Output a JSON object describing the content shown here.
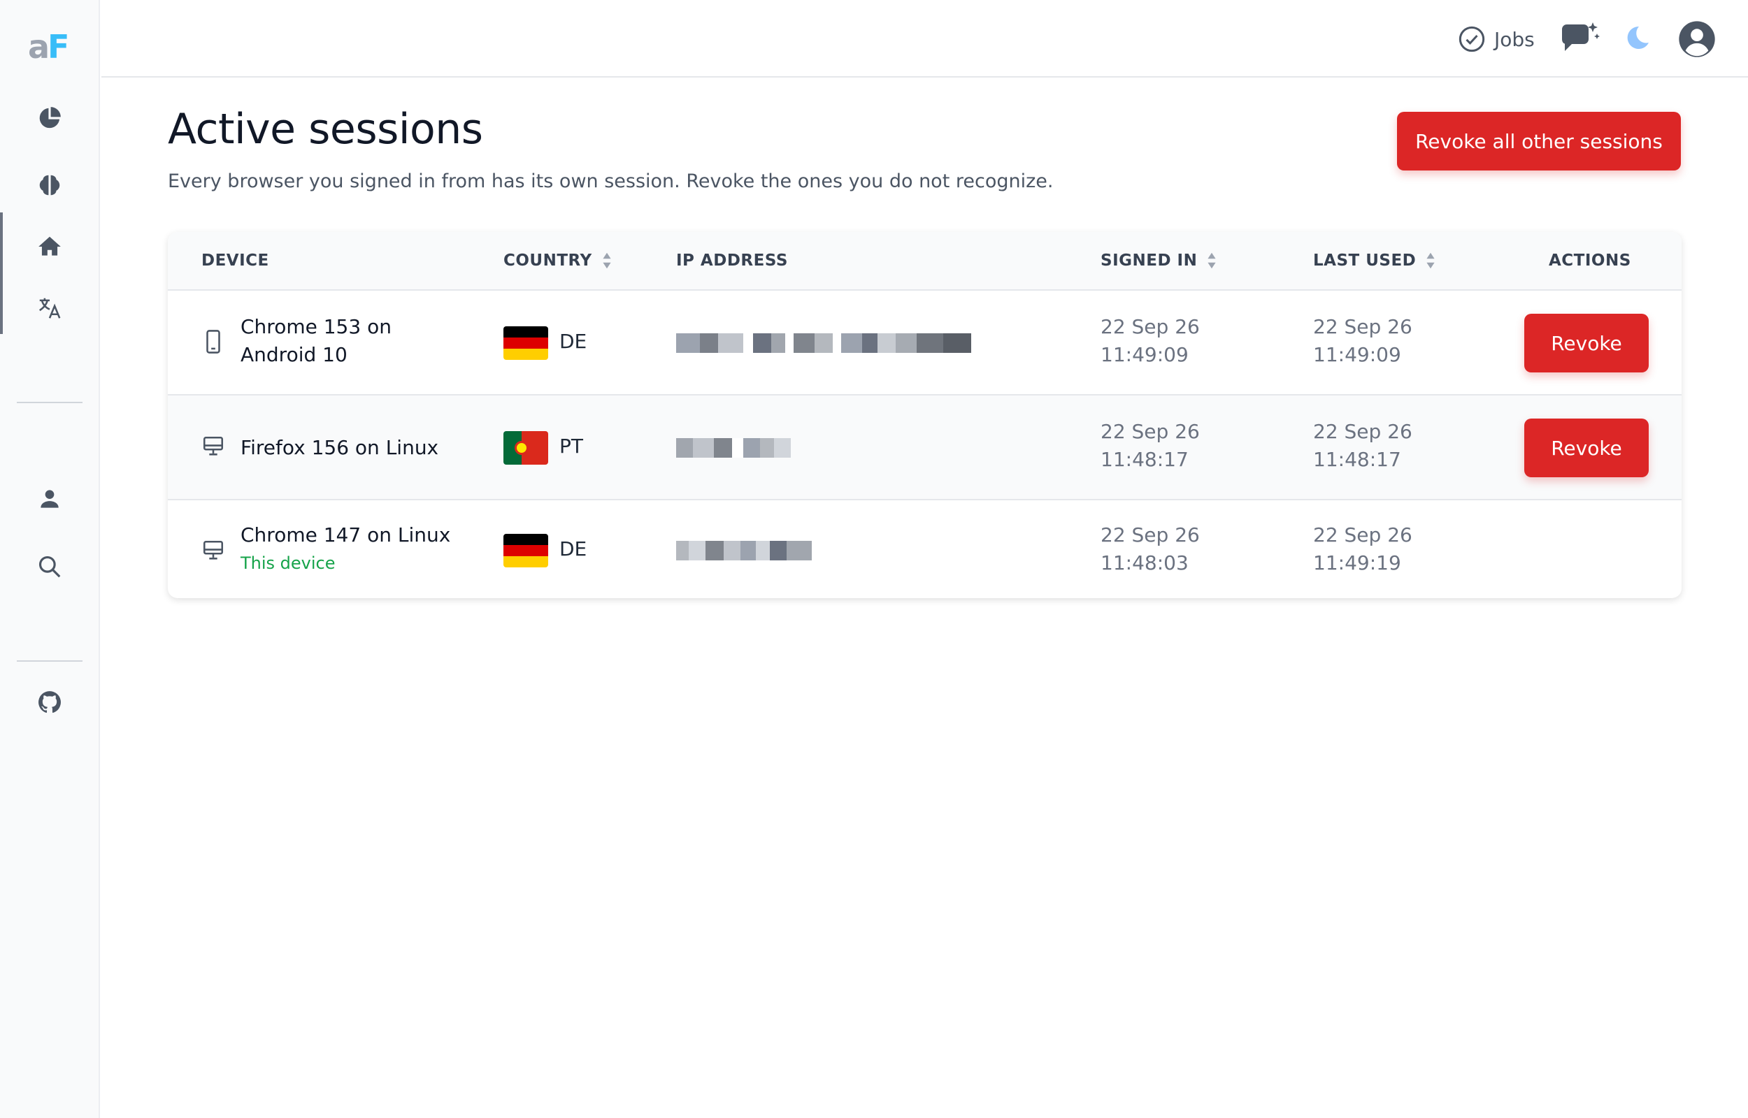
{
  "logo": {
    "part1": "a",
    "part2": "F"
  },
  "sidebar": {
    "icons": [
      "pie-chart-icon",
      "brain-icon",
      "home-icon",
      "translate-icon",
      "user-icon",
      "search-icon",
      "github-icon"
    ]
  },
  "topbar": {
    "jobs_label": "Jobs",
    "icons": [
      "check-circle-icon",
      "chat-sparkle-icon",
      "moon-icon",
      "user-circle-icon"
    ]
  },
  "page": {
    "title": "Active sessions",
    "subtitle": "Every browser you signed in from has its own session. Revoke the ones you do not recognize.",
    "revoke_all_label": "Revoke all other sessions"
  },
  "table": {
    "columns": {
      "device": "DEVICE",
      "country": "COUNTRY",
      "ip": "IP ADDRESS",
      "signed_in": "SIGNED IN",
      "last_used": "LAST USED",
      "actions": "ACTIONS"
    },
    "rows": [
      {
        "device_type": "mobile-icon",
        "device_line1": "Chrome 153 on",
        "device_line2": "Android 10",
        "this_device": "",
        "country_code": "DE",
        "ip": "blurred",
        "signed_in_date": "22 Sep 26",
        "signed_in_time": "11:49:09",
        "last_used_date": "22 Sep 26",
        "last_used_time": "11:49:09",
        "action_label": "Revoke"
      },
      {
        "device_type": "desktop-icon",
        "device_line1": "Firefox 156 on Linux",
        "device_line2": "",
        "this_device": "",
        "country_code": "PT",
        "ip": "blurred",
        "signed_in_date": "22 Sep 26",
        "signed_in_time": "11:48:17",
        "last_used_date": "22 Sep 26",
        "last_used_time": "11:48:17",
        "action_label": "Revoke"
      },
      {
        "device_type": "desktop-icon",
        "device_line1": "Chrome 147 on Linux",
        "device_line2": "",
        "this_device": "This device",
        "country_code": "DE",
        "ip": "blurred",
        "signed_in_date": "22 Sep 26",
        "signed_in_time": "11:48:03",
        "last_used_date": "22 Sep 26",
        "last_used_time": "11:49:19",
        "action_label": ""
      }
    ]
  },
  "colors": {
    "accent_red": "#dc2626",
    "logo_blue": "#38bdf8",
    "this_device_green": "#16a34a"
  }
}
